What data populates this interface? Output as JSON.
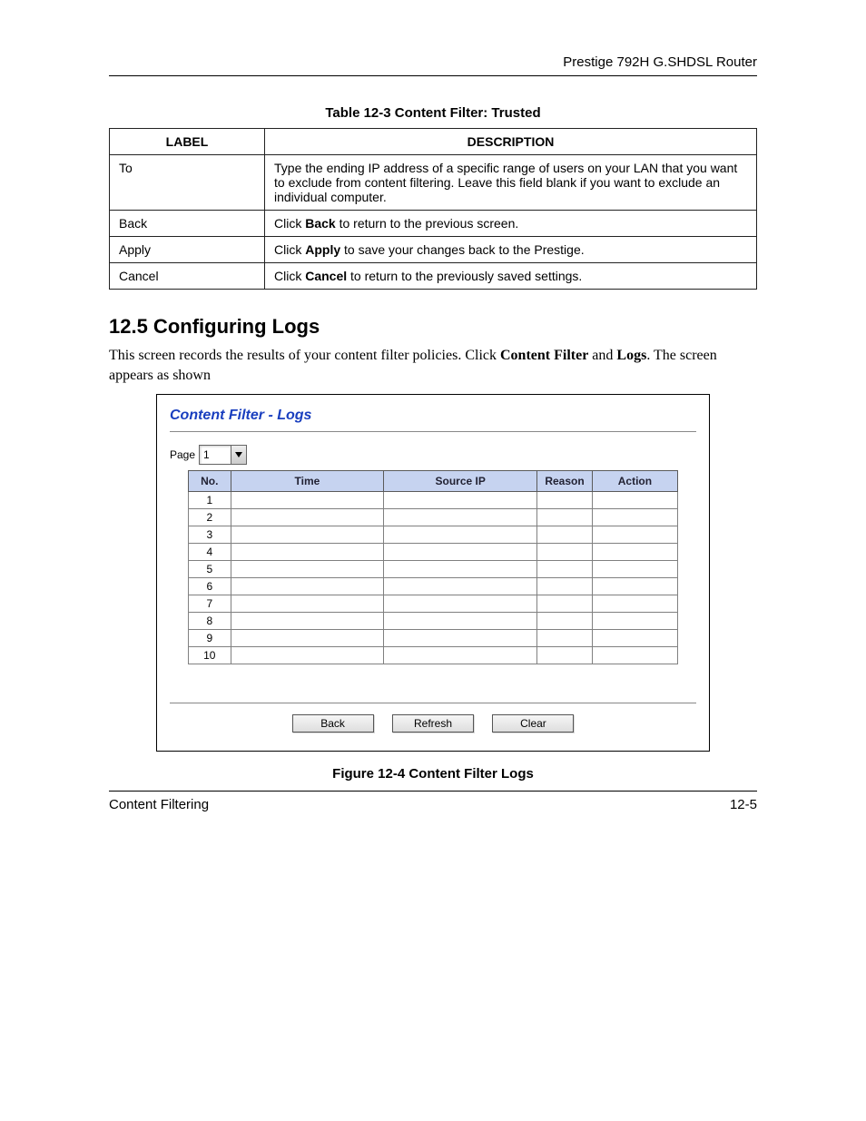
{
  "header": {
    "running_head": "Prestige 792H G.SHDSL Router"
  },
  "table": {
    "caption": "Table 12-3 Content Filter: Trusted",
    "columns": {
      "label": "LABEL",
      "description": "DESCRIPTION"
    },
    "rows": [
      {
        "label": "To",
        "desc_pre": "Type the ending IP address of a specific range of users on your LAN that you want to exclude from content filtering. Leave this field blank if you want to exclude an individual computer.",
        "desc_bold": "",
        "desc_post": ""
      },
      {
        "label": "Back",
        "desc_pre": "Click ",
        "desc_bold": "Back",
        "desc_post": " to return to the previous screen."
      },
      {
        "label": "Apply",
        "desc_pre": "Click ",
        "desc_bold": "Apply",
        "desc_post": " to save your changes back to the Prestige."
      },
      {
        "label": "Cancel",
        "desc_pre": "Click ",
        "desc_bold": "Cancel",
        "desc_post": " to return to the previously saved settings."
      }
    ]
  },
  "section": {
    "heading": "12.5  Configuring Logs",
    "body_pre": "This screen records the results of your content filter policies. Click ",
    "body_b1": "Content Filter",
    "body_mid": " and ",
    "body_b2": "Logs",
    "body_post": ". The screen appears as shown"
  },
  "ui": {
    "title": "Content Filter - Logs",
    "page_label": "Page",
    "page_value": "1",
    "columns": {
      "no": "No.",
      "time": "Time",
      "source_ip": "Source IP",
      "reason": "Reason",
      "action": "Action"
    },
    "rows": [
      {
        "no": "1",
        "time": "",
        "source_ip": "",
        "reason": "",
        "action": ""
      },
      {
        "no": "2",
        "time": "",
        "source_ip": "",
        "reason": "",
        "action": ""
      },
      {
        "no": "3",
        "time": "",
        "source_ip": "",
        "reason": "",
        "action": ""
      },
      {
        "no": "4",
        "time": "",
        "source_ip": "",
        "reason": "",
        "action": ""
      },
      {
        "no": "5",
        "time": "",
        "source_ip": "",
        "reason": "",
        "action": ""
      },
      {
        "no": "6",
        "time": "",
        "source_ip": "",
        "reason": "",
        "action": ""
      },
      {
        "no": "7",
        "time": "",
        "source_ip": "",
        "reason": "",
        "action": ""
      },
      {
        "no": "8",
        "time": "",
        "source_ip": "",
        "reason": "",
        "action": ""
      },
      {
        "no": "9",
        "time": "",
        "source_ip": "",
        "reason": "",
        "action": ""
      },
      {
        "no": "10",
        "time": "",
        "source_ip": "",
        "reason": "",
        "action": ""
      }
    ],
    "buttons": {
      "back": "Back",
      "refresh": "Refresh",
      "clear": "Clear"
    }
  },
  "figure": {
    "caption": "Figure 12-4 Content Filter Logs"
  },
  "footer": {
    "left": "Content Filtering",
    "right": "12-5"
  }
}
